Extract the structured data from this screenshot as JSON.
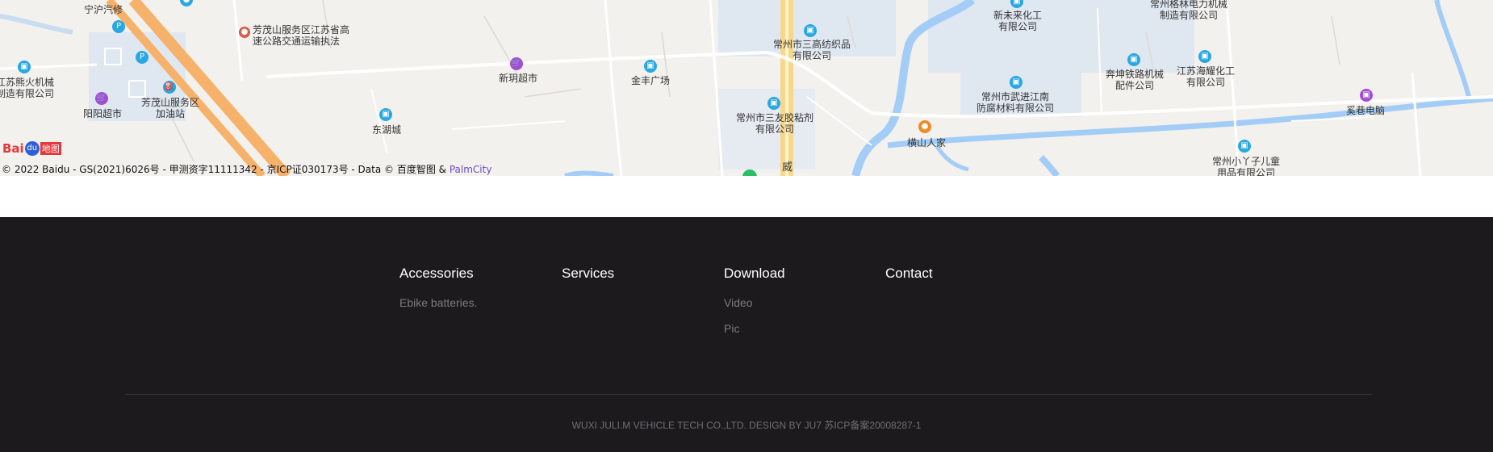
{
  "map": {
    "copyright_text": "© 2022 Baidu - GS(2021)6026号 - 甲测资字11111342 - 京ICP证030173号 - Data © 百度智图 & ",
    "copyright_link": "PalmCity",
    "logo_text_bai": "Bai",
    "logo_text_du": "du",
    "logo_text_map": "地图",
    "pois": [
      {
        "name": "宁沪汽修"
      },
      {
        "name": "芳茂山服务区江苏省高\n速公路交通运输执法"
      },
      {
        "name": "江苏熊火机械\n制造有限公司"
      },
      {
        "name": "阳阳超市"
      },
      {
        "name": "芳茂山服务区\n加油站"
      },
      {
        "name": "新玥超市"
      },
      {
        "name": "东湖城"
      },
      {
        "name": "金丰广场"
      },
      {
        "name": "常州市三高纺织品\n有限公司"
      },
      {
        "name": "常州市三友胶粘剂\n有限公司"
      },
      {
        "name": "横山人家"
      },
      {
        "name": "新未来化工\n有限公司"
      },
      {
        "name": "常州市武进江南\n防腐材料有限公司"
      },
      {
        "name": "常州格林电力机械\n制造有限公司"
      },
      {
        "name": "奔坤铁路机械\n配件公司"
      },
      {
        "name": "江苏海耀化工\n有限公司"
      },
      {
        "name": "常州小丫子儿童\n用品有限公司"
      },
      {
        "name": "奚巷电脑"
      },
      {
        "name": "威"
      }
    ]
  },
  "footer": {
    "columns": [
      {
        "title": "Accessories",
        "links": [
          "Ebike batteries."
        ]
      },
      {
        "title": "Services",
        "links": []
      },
      {
        "title": "Download",
        "links": [
          "Video",
          "Pic"
        ]
      },
      {
        "title": "Contact",
        "links": []
      }
    ],
    "bottom_text": "WUXI JULI.M VEHICLE TECH CO.,LTD. DESIGN BY JU7 苏ICP备案20008287-1"
  },
  "colors": {
    "footer_bg": "#1c1a1d",
    "water": "#a3cdf6",
    "highway": "#f6b26b",
    "map_bg": "#f3f1ed",
    "poi_blue": "#28a7e1",
    "poi_purple": "#a54bd6",
    "poi_orange": "#f08a24"
  }
}
